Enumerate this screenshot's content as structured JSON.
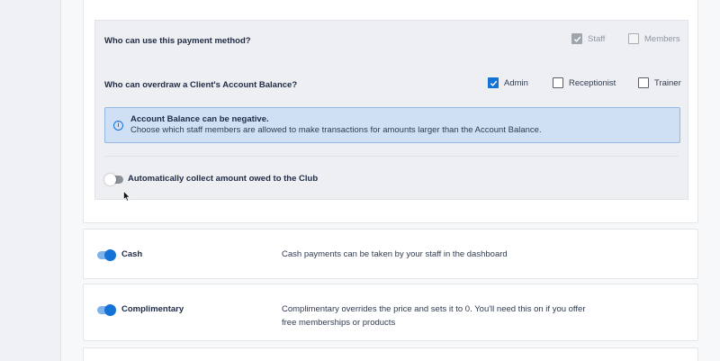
{
  "payment_settings": {
    "who_can_use": {
      "label": "Who can use this payment method?",
      "options": [
        {
          "label": "Staff",
          "checked": true,
          "disabled": true
        },
        {
          "label": "Members",
          "checked": false,
          "disabled": true
        }
      ]
    },
    "who_can_overdraw": {
      "label": "Who can overdraw a Client's Account Balance?",
      "options": [
        {
          "label": "Admin",
          "checked": true
        },
        {
          "label": "Receptionist",
          "checked": false
        },
        {
          "label": "Trainer",
          "checked": false
        }
      ]
    },
    "info": {
      "icon": "info-icon",
      "title": "Account Balance can be negative.",
      "text": "Choose which staff members are allowed to make transactions for amounts larger than the Account Balance."
    },
    "auto_collect": {
      "label": "Automatically collect amount owed to the Club",
      "enabled": false
    }
  },
  "payment_methods": [
    {
      "name": "Cash",
      "enabled": true,
      "description": "Cash payments can be taken by your staff in the dashboard"
    },
    {
      "name": "Complimentary",
      "enabled": true,
      "description": "Complimentary overrides the price and sets it to 0. You'll need this on if you offer free memberships or products"
    }
  ],
  "colors": {
    "accent": "#1573d6",
    "info_bg": "#cfe0f4",
    "panel_bg": "#eeeff2"
  }
}
